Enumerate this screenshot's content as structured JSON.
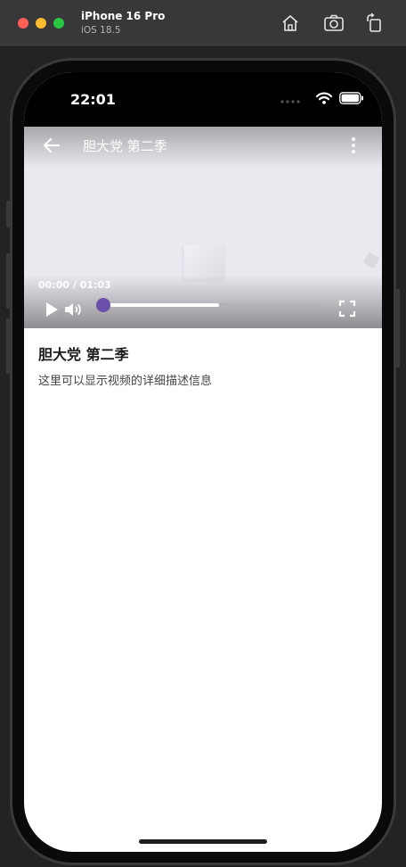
{
  "simulator": {
    "device_name": "iPhone 16 Pro",
    "os_version": "iOS 18.5",
    "icons": [
      "home-icon",
      "screenshot-icon",
      "rotate-icon"
    ]
  },
  "status_bar": {
    "time": "22:01",
    "icons": [
      "wifi-icon",
      "battery-icon"
    ]
  },
  "player": {
    "title": "胆大党 第二季",
    "time_display": "00:00 / 01:03",
    "progress": 0,
    "buffered": 0.54,
    "icons": [
      "back-arrow-icon",
      "more-vert-icon",
      "play-icon",
      "volume-icon",
      "fullscreen-icon"
    ],
    "accent_color": "#6a4fab"
  },
  "content": {
    "title": "胆大党 第二季",
    "description": "这里可以显示视频的详细描述信息"
  }
}
